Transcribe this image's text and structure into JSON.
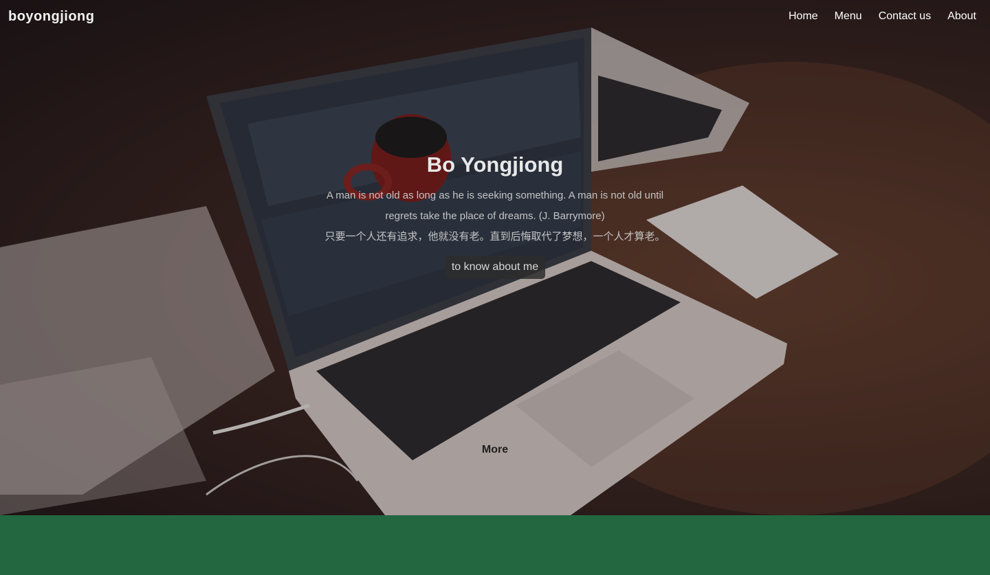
{
  "nav": {
    "brand": "boyongjiong",
    "links": [
      {
        "label": "Home"
      },
      {
        "label": "Menu"
      },
      {
        "label": "Contact us"
      },
      {
        "label": "About"
      }
    ]
  },
  "hero": {
    "title": "Bo Yongjiong",
    "quote_en": "A man is not old as long as he is seeking something. A man is not old until regrets take the place of dreams. (J. Barrymore)",
    "quote_zh": "只要一个人还有追求，他就没有老。直到后悔取代了梦想，一个人才算老。",
    "button_label": "to know about me",
    "more_label": "More"
  },
  "colors": {
    "footer_band": "#236741"
  }
}
